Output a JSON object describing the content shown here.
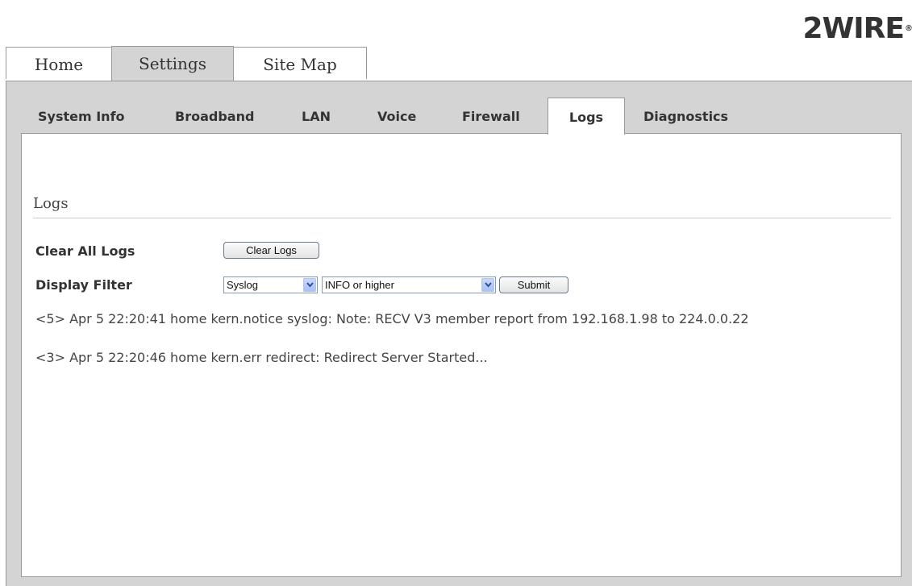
{
  "brand": {
    "logo_text": "2WIRE",
    "reg_mark": "®"
  },
  "top_tabs": [
    {
      "label": "Home"
    },
    {
      "label": "Settings",
      "active": true
    },
    {
      "label": "Site Map"
    }
  ],
  "sub_tabs": [
    {
      "label": "System Info"
    },
    {
      "label": "Broadband"
    },
    {
      "label": "LAN"
    },
    {
      "label": "Voice"
    },
    {
      "label": "Firewall"
    },
    {
      "label": "Logs",
      "active": true
    },
    {
      "label": "Diagnostics"
    }
  ],
  "section": {
    "title": "Logs"
  },
  "clear": {
    "label": "Clear All Logs",
    "button": "Clear Logs"
  },
  "filter": {
    "label": "Display Filter",
    "source_value": "Syslog",
    "level_value": "INFO or higher",
    "submit": "Submit"
  },
  "logs": [
    "<5> Apr 5 22:20:41 home kern.notice syslog: Note: RECV V3 member report from 192.168.1.98 to 224.0.0.22",
    "<3> Apr 5 22:20:46 home kern.err redirect: Redirect Server Started..."
  ],
  "colors": {
    "frame": "#d4d4d4",
    "border": "#999999",
    "select_arrow": "#a9c1f5"
  }
}
